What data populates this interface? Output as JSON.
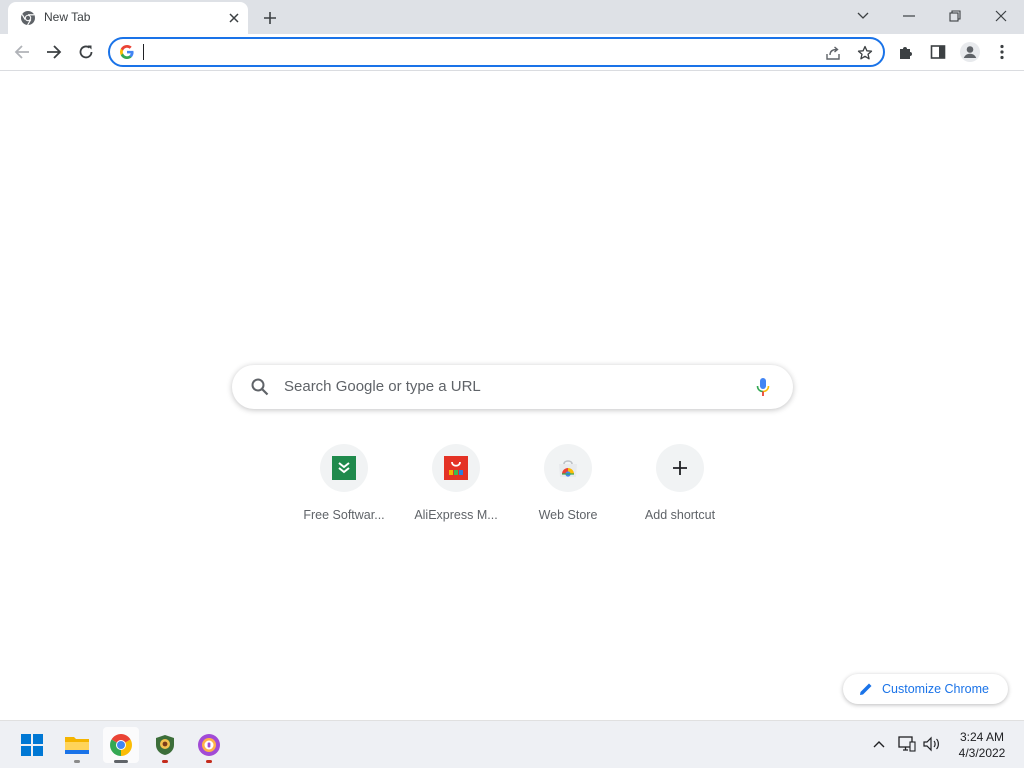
{
  "browser": {
    "tab_title": "New Tab",
    "omnibox_value": "",
    "accent_color": "#1a73e8"
  },
  "ntp": {
    "search_placeholder": "Search Google or type a URL",
    "shortcuts": [
      {
        "label": "Free Softwar...",
        "icon": "free-software-icon"
      },
      {
        "label": "AliExpress M...",
        "icon": "aliexpress-icon"
      },
      {
        "label": "Web Store",
        "icon": "web-store-icon"
      },
      {
        "label": "Add shortcut",
        "icon": "plus-icon"
      }
    ],
    "customize_label": "Customize Chrome"
  },
  "taskbar": {
    "apps": [
      "start-icon",
      "file-explorer-icon",
      "chrome-icon",
      "app-shield-icon",
      "app-vpn-icon"
    ],
    "time": "3:24 AM",
    "date": "4/3/2022"
  }
}
